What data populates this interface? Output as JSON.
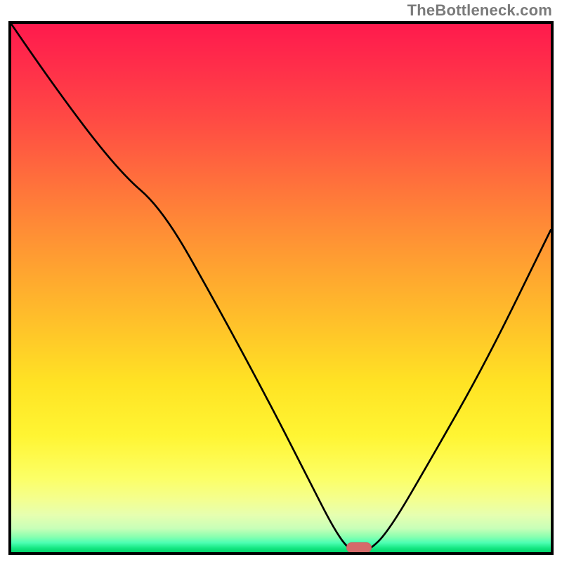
{
  "credit": "TheBottleneck.com",
  "chart_data": {
    "type": "line",
    "title": "",
    "xlabel": "",
    "ylabel": "",
    "xlim": [
      0,
      100
    ],
    "ylim": [
      0,
      100
    ],
    "curve": {
      "x": [
        0,
        8,
        20,
        28,
        38,
        48,
        55,
        60,
        63,
        66,
        70,
        78,
        88,
        100
      ],
      "y": [
        100,
        88,
        72,
        65,
        47,
        28,
        14,
        4,
        0,
        0,
        4,
        18,
        36,
        61
      ]
    },
    "marker": {
      "x": 64.5,
      "y": 0.8
    },
    "gradient_stops": [
      {
        "pos": 0,
        "color": "#ff1a4d"
      },
      {
        "pos": 8,
        "color": "#ff2e4a"
      },
      {
        "pos": 18,
        "color": "#ff4a44"
      },
      {
        "pos": 28,
        "color": "#ff6a3d"
      },
      {
        "pos": 38,
        "color": "#ff8a36"
      },
      {
        "pos": 48,
        "color": "#ffa82f"
      },
      {
        "pos": 58,
        "color": "#ffc529"
      },
      {
        "pos": 68,
        "color": "#ffe324"
      },
      {
        "pos": 78,
        "color": "#fff533"
      },
      {
        "pos": 86,
        "color": "#fcff66"
      },
      {
        "pos": 90,
        "color": "#f4ff8f"
      },
      {
        "pos": 93,
        "color": "#e6ffb0"
      },
      {
        "pos": 95.5,
        "color": "#c8ffb8"
      },
      {
        "pos": 97,
        "color": "#8dffb0"
      },
      {
        "pos": 98.2,
        "color": "#4dffb3"
      },
      {
        "pos": 99.2,
        "color": "#17e884"
      },
      {
        "pos": 100,
        "color": "#00d46a"
      }
    ]
  }
}
